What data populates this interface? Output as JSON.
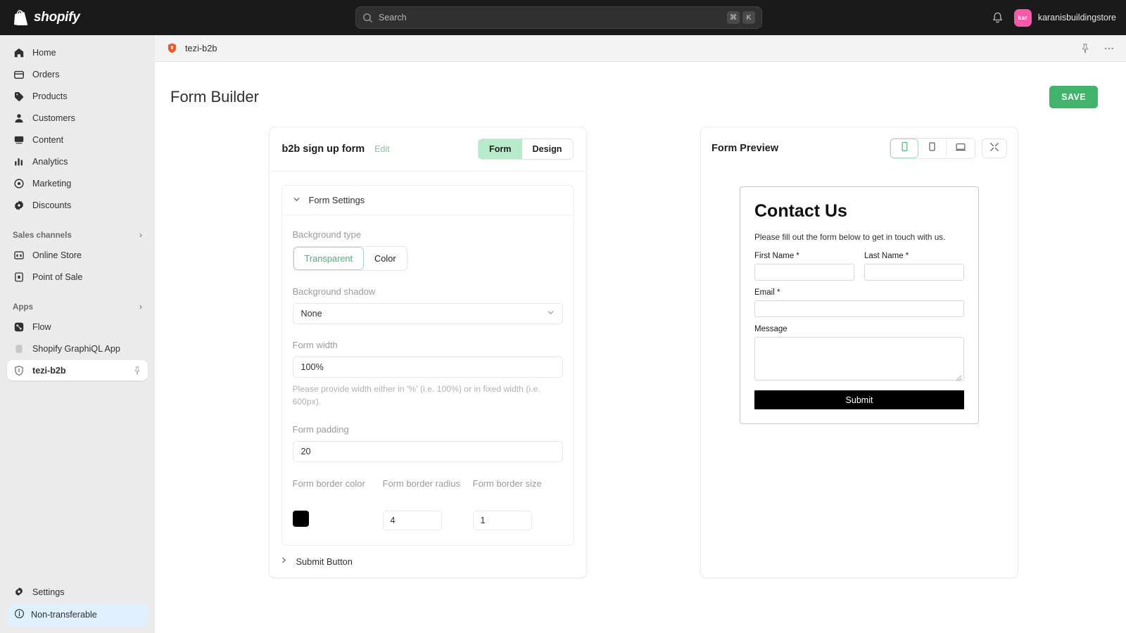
{
  "topbar": {
    "brand": "shopify",
    "search": {
      "placeholder": "Search",
      "kbd1": "⌘",
      "kbd2": "K"
    },
    "account": {
      "initials": "kar",
      "name": "karanisbuildingstore"
    }
  },
  "sidebar": {
    "items": [
      {
        "label": "Home",
        "icon": "home-icon"
      },
      {
        "label": "Orders",
        "icon": "orders-icon"
      },
      {
        "label": "Products",
        "icon": "products-icon"
      },
      {
        "label": "Customers",
        "icon": "customers-icon"
      },
      {
        "label": "Content",
        "icon": "content-icon"
      },
      {
        "label": "Analytics",
        "icon": "analytics-icon"
      },
      {
        "label": "Marketing",
        "icon": "marketing-icon"
      },
      {
        "label": "Discounts",
        "icon": "discounts-icon"
      }
    ],
    "sales_channels": {
      "heading": "Sales channels",
      "items": [
        {
          "label": "Online Store",
          "icon": "online-store-icon"
        },
        {
          "label": "Point of Sale",
          "icon": "point-of-sale-icon"
        }
      ]
    },
    "apps": {
      "heading": "Apps",
      "items": [
        {
          "label": "Flow",
          "icon": "flow-icon"
        },
        {
          "label": "Shopify GraphiQL App",
          "icon": "graphiql-icon"
        },
        {
          "label": "tezi-b2b",
          "icon": "shield-icon",
          "active": true,
          "pinned": true
        }
      ]
    },
    "settings": {
      "label": "Settings",
      "icon": "gear-icon"
    },
    "banner": {
      "label": "Non-transferable",
      "icon": "info-icon",
      "color": "#e0f0ff"
    }
  },
  "appbar": {
    "title": "tezi-b2b"
  },
  "page": {
    "title": "Form Builder",
    "save_label": "SAVE",
    "save_color": "#41b36a"
  },
  "form_card": {
    "title": "b2b sign up form",
    "edit_label": "Edit",
    "tabs": [
      {
        "label": "Form",
        "active": true
      },
      {
        "label": "Design",
        "active": false
      }
    ],
    "section": {
      "title": "Form Settings",
      "expanded": true
    },
    "fields": {
      "background_type": {
        "label": "Background type",
        "options": [
          {
            "label": "Transparent",
            "selected": true
          },
          {
            "label": "Color",
            "selected": false
          }
        ]
      },
      "background_shadow": {
        "label": "Background shadow",
        "value": "None"
      },
      "form_width": {
        "label": "Form width",
        "value": "100%",
        "help": "Please provide width either in '%' (i.e. 100%) or in fixed width (i.e. 600px)."
      },
      "form_padding": {
        "label": "Form padding",
        "value": "20"
      },
      "border_color": {
        "label": "Form border color",
        "value": "#000000"
      },
      "border_radius": {
        "label": "Form border radius",
        "value": "4"
      },
      "border_size": {
        "label": "Form border size",
        "value": "1"
      }
    },
    "submit_section": {
      "title": "Submit Button",
      "expanded": false
    }
  },
  "preview": {
    "title": "Form Preview",
    "devices": [
      {
        "name": "mobile",
        "active": true
      },
      {
        "name": "tablet",
        "active": false
      },
      {
        "name": "desktop",
        "active": false
      }
    ],
    "expand": "fullscreen",
    "form": {
      "heading": "Contact Us",
      "subtext": "Please fill out the form below to get in touch with us.",
      "first_name_label": "First Name *",
      "last_name_label": "Last Name *",
      "email_label": "Email *",
      "message_label": "Message",
      "submit_label": "Submit",
      "submit_bg": "#000000"
    }
  }
}
